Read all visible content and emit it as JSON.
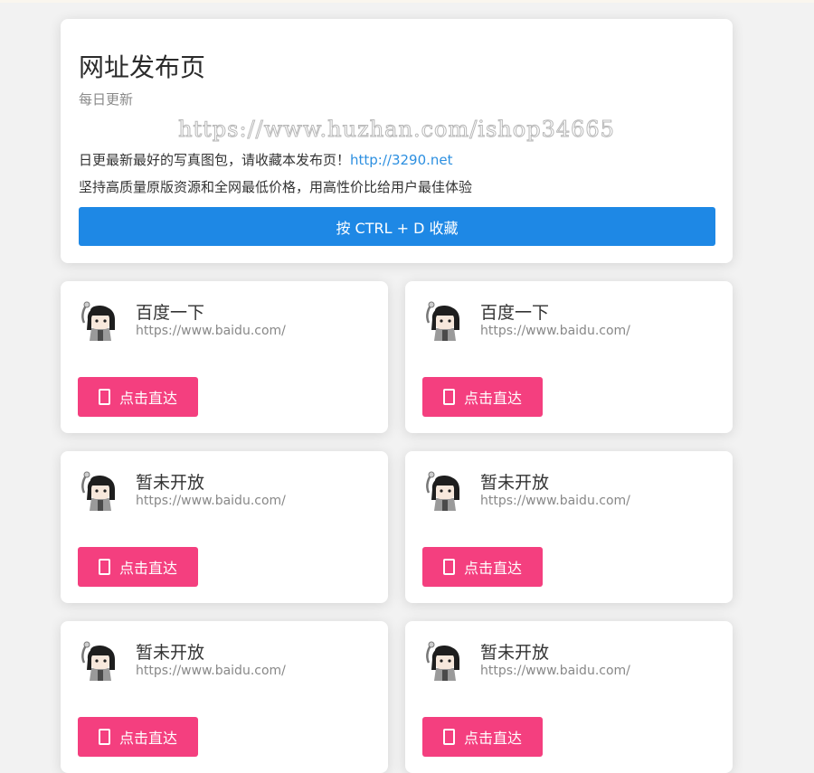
{
  "header": {
    "title": "网址发布页",
    "subtitle": "每日更新",
    "watermark": "https://www.huzhan.com/ishop34665",
    "line1_text": "日更最新最好的写真图包，请收藏本发布页！",
    "line1_link": "http://3290.net",
    "line2_text": "坚持高质量原版资源和全网最低价格，用高性价比给用户最佳体验",
    "bookmark_button": "按 CTRL + D 收藏"
  },
  "sites": [
    {
      "name": "百度一下",
      "url": "https://www.baidu.com/",
      "button": "点击直达"
    },
    {
      "name": "百度一下",
      "url": "https://www.baidu.com/",
      "button": "点击直达"
    },
    {
      "name": "暂未开放",
      "url": "https://www.baidu.com/",
      "button": "点击直达"
    },
    {
      "name": "暂未开放",
      "url": "https://www.baidu.com/",
      "button": "点击直达"
    },
    {
      "name": "暂未开放",
      "url": "https://www.baidu.com/",
      "button": "点击直达"
    },
    {
      "name": "暂未开放",
      "url": "https://www.baidu.com/",
      "button": "点击直达"
    }
  ],
  "colors": {
    "primary_button": "#1e88e5",
    "go_button": "#f43f7f",
    "link": "#2c8fe0"
  },
  "icons": {
    "avatar": "anime-avatar-icon",
    "go_button": "phone-icon"
  }
}
